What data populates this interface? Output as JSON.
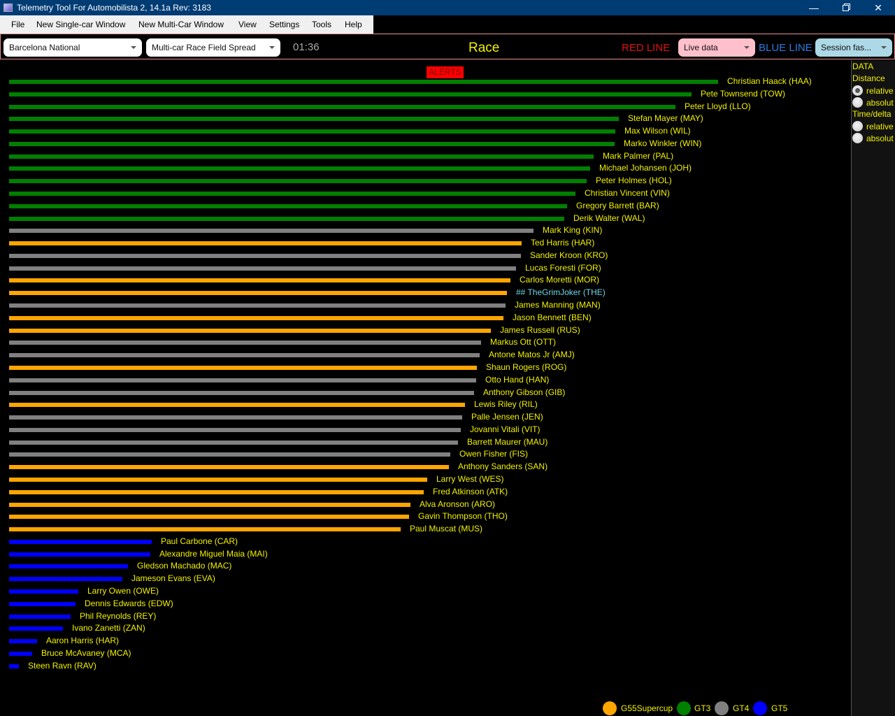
{
  "window": {
    "title": "Telemetry Tool For Automobilista 2, 14.1a Rev: 3183",
    "controls": [
      "minimize",
      "restore",
      "close"
    ]
  },
  "menu": [
    "File",
    "New Single-car Window",
    "New Multi-Car Window",
    "View",
    "Settings",
    "Tools",
    "Help"
  ],
  "toolbar": {
    "track_select": "Barcelona National",
    "view_select": "Multi-car Race Field Spread",
    "timer": "01:36",
    "session": "Race",
    "red_line_label": "RED LINE",
    "red_line_select": "Live data",
    "blue_line_label": "BLUE LINE",
    "blue_line_select": "Session fas..."
  },
  "alerts_label": "ALERTS",
  "side_panel": {
    "header": "DATA",
    "distance_label": "Distance",
    "distance_options": [
      {
        "label": "relative",
        "checked": true
      },
      {
        "label": "absolut",
        "checked": false
      }
    ],
    "time_label": "Time/delta",
    "time_options": [
      {
        "label": "relative",
        "checked": false
      },
      {
        "label": "absolut",
        "checked": false
      }
    ]
  },
  "class_colors": {
    "G55Supercup": "#ffa500",
    "GT3": "#008000",
    "GT4": "#808080",
    "GT5": "#0000ff"
  },
  "chart_data": {
    "type": "bar",
    "orientation": "horizontal",
    "title": "Multi-car Race Field Spread",
    "xlabel": "",
    "ylabel": "",
    "value_unit": "relative distance (0 = last car position, 1 = leader)",
    "legend": {
      "placement": "bottom-right",
      "entries": [
        {
          "name": "G55Supercup",
          "color": "#ffa500"
        },
        {
          "name": "GT3",
          "color": "#008000"
        },
        {
          "name": "GT4",
          "color": "#808080"
        },
        {
          "name": "GT5",
          "color": "#0000ff"
        }
      ]
    },
    "bars": [
      {
        "label": "Christian Haack (HAA)",
        "class": "GT3",
        "value": 1.0
      },
      {
        "label": "Pete Townsend (TOW)",
        "class": "GT3",
        "value": 0.963
      },
      {
        "label": "Peter Lloyd (LLO)",
        "class": "GT3",
        "value": 0.94
      },
      {
        "label": "Stefan Mayer (MAY)",
        "class": "GT3",
        "value": 0.86
      },
      {
        "label": "Max Wilson (WIL)",
        "class": "GT3",
        "value": 0.855
      },
      {
        "label": "Marko Winkler (WIN)",
        "class": "GT3",
        "value": 0.854
      },
      {
        "label": "Mark Palmer (PAL)",
        "class": "GT3",
        "value": 0.824
      },
      {
        "label": "Michael Johansen (JOH)",
        "class": "GT3",
        "value": 0.82
      },
      {
        "label": "Peter Holmes (HOL)",
        "class": "GT3",
        "value": 0.815
      },
      {
        "label": "Christian Vincent (VIN)",
        "class": "GT3",
        "value": 0.799
      },
      {
        "label": "Gregory Barrett (BAR)",
        "class": "GT3",
        "value": 0.787
      },
      {
        "label": "Derik Walter (WAL)",
        "class": "GT3",
        "value": 0.783
      },
      {
        "label": "Mark King (KIN)",
        "class": "GT4",
        "value": 0.74
      },
      {
        "label": "Ted Harris (HAR)",
        "class": "G55Supercup",
        "value": 0.723
      },
      {
        "label": "Sander Kroon (KRO)",
        "class": "GT4",
        "value": 0.722
      },
      {
        "label": "Lucas Foresti (FOR)",
        "class": "GT4",
        "value": 0.715
      },
      {
        "label": "Carlos Moretti (MOR)",
        "class": "G55Supercup",
        "value": 0.707
      },
      {
        "label": "## TheGrimJoker (THE)",
        "class": "G55Supercup",
        "value": 0.702,
        "highlight": true
      },
      {
        "label": "James Manning (MAN)",
        "class": "GT4",
        "value": 0.7
      },
      {
        "label": "Jason Bennett (BEN)",
        "class": "G55Supercup",
        "value": 0.697
      },
      {
        "label": "James Russell (RUS)",
        "class": "G55Supercup",
        "value": 0.679
      },
      {
        "label": "Markus Ott (OTT)",
        "class": "GT4",
        "value": 0.666
      },
      {
        "label": "Antone Matos Jr (AMJ)",
        "class": "GT4",
        "value": 0.664
      },
      {
        "label": "Shaun Rogers (ROG)",
        "class": "G55Supercup",
        "value": 0.66
      },
      {
        "label": "Otto Hand (HAN)",
        "class": "GT4",
        "value": 0.659
      },
      {
        "label": "Anthony Gibson (GIB)",
        "class": "GT4",
        "value": 0.656
      },
      {
        "label": "Lewis Riley (RIL)",
        "class": "G55Supercup",
        "value": 0.643
      },
      {
        "label": "Palle Jensen (JEN)",
        "class": "GT4",
        "value": 0.639
      },
      {
        "label": "Jovanni Vitali (VIT)",
        "class": "GT4",
        "value": 0.637
      },
      {
        "label": "Barrett Maurer (MAU)",
        "class": "GT4",
        "value": 0.633
      },
      {
        "label": "Owen Fisher (FIS)",
        "class": "GT4",
        "value": 0.622
      },
      {
        "label": "Anthony Sanders (SAN)",
        "class": "G55Supercup",
        "value": 0.62
      },
      {
        "label": "Larry West (WES)",
        "class": "G55Supercup",
        "value": 0.59
      },
      {
        "label": "Fred Atkinson (ATK)",
        "class": "G55Supercup",
        "value": 0.585
      },
      {
        "label": "Alva Aronson (ARO)",
        "class": "G55Supercup",
        "value": 0.566
      },
      {
        "label": "Gavin Thompson (THO)",
        "class": "G55Supercup",
        "value": 0.564
      },
      {
        "label": "Paul Muscat (MUS)",
        "class": "G55Supercup",
        "value": 0.552
      },
      {
        "label": "Paul Carbone (CAR)",
        "class": "GT5",
        "value": 0.201
      },
      {
        "label": "Alexandre Miguel Maia (MAI)",
        "class": "GT5",
        "value": 0.199
      },
      {
        "label": "Gledson Machado (MAC)",
        "class": "GT5",
        "value": 0.168
      },
      {
        "label": "Jameson Evans (EVA)",
        "class": "GT5",
        "value": 0.16
      },
      {
        "label": "Larry Owen (OWE)",
        "class": "GT5",
        "value": 0.098
      },
      {
        "label": "Dennis Edwards (EDW)",
        "class": "GT5",
        "value": 0.094
      },
      {
        "label": "Phil Reynolds (REY)",
        "class": "GT5",
        "value": 0.087
      },
      {
        "label": "Ivano Zanetti (ZAN)",
        "class": "GT5",
        "value": 0.076
      },
      {
        "label": "Aaron Harris (HAR)",
        "class": "GT5",
        "value": 0.039
      },
      {
        "label": "Bruce McAvaney (MCA)",
        "class": "GT5",
        "value": 0.033
      },
      {
        "label": "Steen Ravn (RAV)",
        "class": "GT5",
        "value": 0.014
      }
    ],
    "xlim": [
      0,
      1
    ],
    "grid": false
  }
}
